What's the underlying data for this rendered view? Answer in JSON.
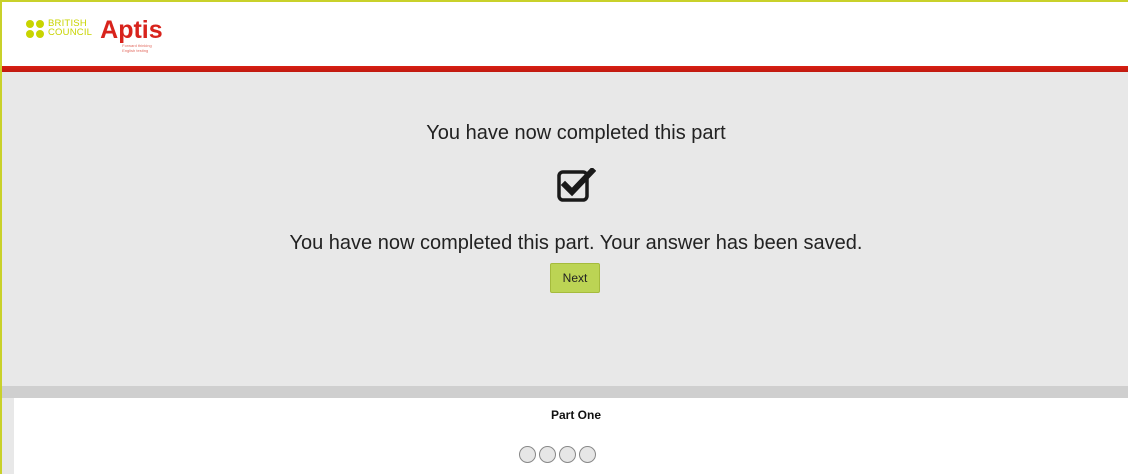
{
  "header": {
    "logo_org": "BRITISH\nCOUNCIL",
    "logo_product": "Aptis",
    "logo_tagline": "Forward thinking\nEnglish testing",
    "brand_color": "#d8231c",
    "accent_color": "#c8d400"
  },
  "main": {
    "title": "You have now completed this part",
    "icon": "checked-box-icon",
    "message": "You have now completed this part. Your answer has been saved.",
    "next_label": "Next"
  },
  "footer": {
    "part_label": "Part One",
    "progress_dots": 4
  }
}
